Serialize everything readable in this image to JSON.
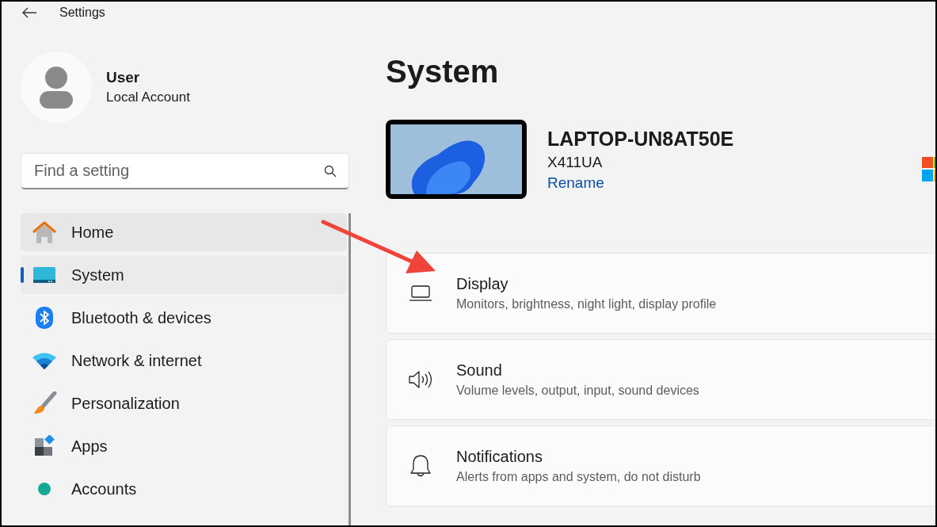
{
  "window": {
    "title": "Settings"
  },
  "user": {
    "name": "User",
    "account_type": "Local Account"
  },
  "search": {
    "placeholder": "Find a setting"
  },
  "sidebar": {
    "items": [
      {
        "label": "Home",
        "selected": false,
        "hovered": true
      },
      {
        "label": "System",
        "selected": true,
        "hovered": false
      },
      {
        "label": "Bluetooth & devices",
        "selected": false,
        "hovered": false
      },
      {
        "label": "Network & internet",
        "selected": false,
        "hovered": false
      },
      {
        "label": "Personalization",
        "selected": false,
        "hovered": false
      },
      {
        "label": "Apps",
        "selected": false,
        "hovered": false
      },
      {
        "label": "Accounts",
        "selected": false,
        "hovered": false
      }
    ]
  },
  "page": {
    "heading": "System",
    "device": {
      "name": "LAPTOP-UN8AT50E",
      "model": "X411UA",
      "link": "Rename"
    },
    "cards": [
      {
        "title": "Display",
        "description": "Monitors, brightness, night light, display profile"
      },
      {
        "title": "Sound",
        "description": "Volume levels, output, input, sound devices"
      },
      {
        "title": "Notifications",
        "description": "Alerts from apps and system, do not disturb"
      }
    ]
  }
}
